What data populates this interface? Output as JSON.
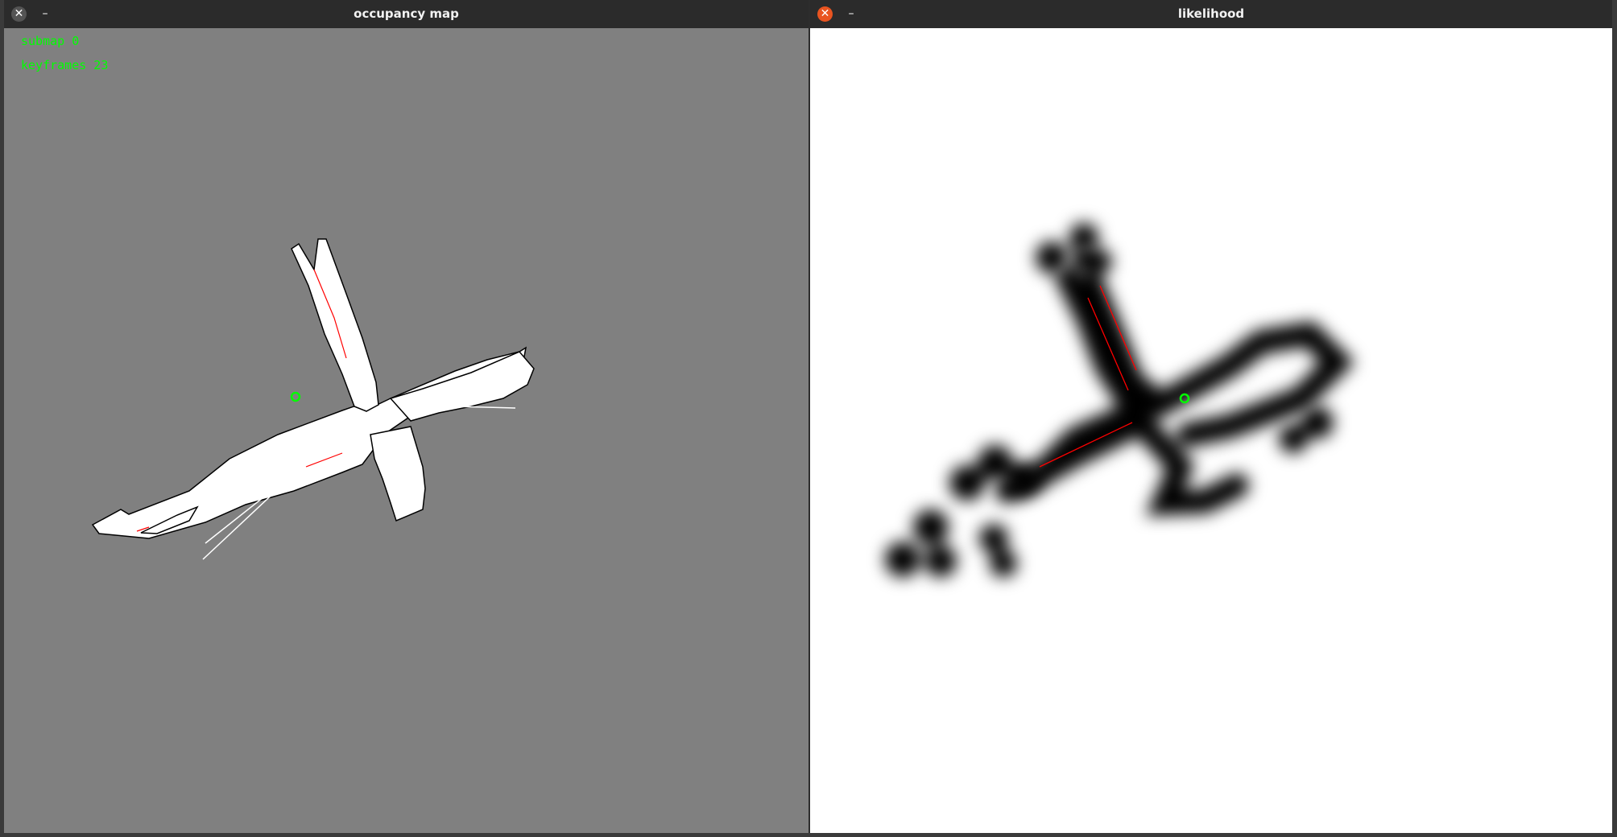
{
  "windows": {
    "occupancy": {
      "title": "occupancy map",
      "close_glyph": "✕",
      "minimize_glyph": "–",
      "overlay": {
        "submap": "submap 0",
        "keyframes": "keyframes 23"
      },
      "colors": {
        "background": "#808080",
        "free": "#ffffff",
        "obstacle": "#000000",
        "marker": "#00ff00"
      }
    },
    "likelihood": {
      "title": "likelihood",
      "close_glyph": "✕",
      "minimize_glyph": "–",
      "colors": {
        "background": "#ffffff",
        "field": "#000000",
        "edge": "#ff0000",
        "marker": "#00ff00"
      }
    }
  }
}
